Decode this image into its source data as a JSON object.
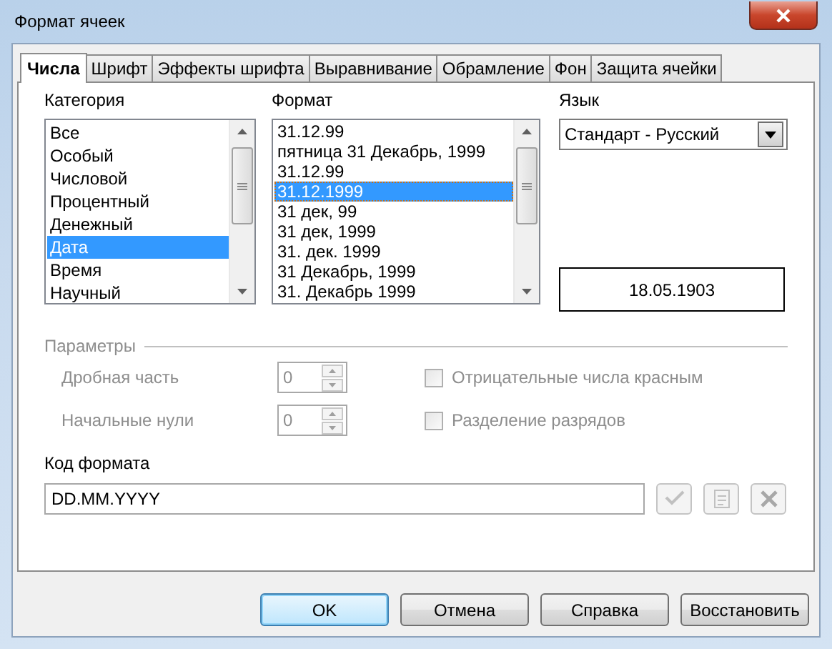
{
  "window": {
    "title": "Формат ячеек"
  },
  "tabs": [
    {
      "label": "Числа",
      "selected": true
    },
    {
      "label": "Шрифт",
      "selected": false
    },
    {
      "label": "Эффекты шрифта",
      "selected": false
    },
    {
      "label": "Выравнивание",
      "selected": false
    },
    {
      "label": "Обрамление",
      "selected": false
    },
    {
      "label": "Фон",
      "selected": false
    },
    {
      "label": "Защита ячейки",
      "selected": false
    }
  ],
  "category": {
    "label": "Категория",
    "items": [
      {
        "label": "Все",
        "selected": false
      },
      {
        "label": "Особый",
        "selected": false
      },
      {
        "label": "Числовой",
        "selected": false
      },
      {
        "label": "Процентный",
        "selected": false
      },
      {
        "label": "Денежный",
        "selected": false
      },
      {
        "label": "Дата",
        "selected": true
      },
      {
        "label": "Время",
        "selected": false
      },
      {
        "label": "Научный",
        "selected": false
      }
    ]
  },
  "format": {
    "label": "Формат",
    "items": [
      {
        "label": "31.12.99",
        "selected": false
      },
      {
        "label": "пятница 31 Декабрь, 1999",
        "selected": false
      },
      {
        "label": "31.12.99",
        "selected": false
      },
      {
        "label": "31.12.1999",
        "selected": true
      },
      {
        "label": "31 дек, 99",
        "selected": false
      },
      {
        "label": "31 дек, 1999",
        "selected": false
      },
      {
        "label": "31. дек. 1999",
        "selected": false
      },
      {
        "label": "31 Декабрь, 1999",
        "selected": false
      },
      {
        "label": "31. Декабрь 1999",
        "selected": false
      }
    ]
  },
  "language": {
    "label": "Язык",
    "value": "Стандарт - Русский"
  },
  "preview": "18.05.1903",
  "parameters": {
    "title": "Параметры",
    "disabled": true,
    "spinners": [
      {
        "label": "Дробная часть",
        "value": "0"
      },
      {
        "label": "Начальные нули",
        "value": "0"
      }
    ],
    "checkboxes": [
      {
        "label": "Отрицательные числа красным",
        "checked": false
      },
      {
        "label": "Разделение разрядов",
        "checked": false
      }
    ]
  },
  "format_code": {
    "label": "Код формата",
    "value": "DD.MM.YYYY"
  },
  "buttons": [
    {
      "label": "OK",
      "default": true
    },
    {
      "label": "Отмена",
      "default": false
    },
    {
      "label": "Справка",
      "default": false
    },
    {
      "label": "Восстановить",
      "default": false
    }
  ]
}
